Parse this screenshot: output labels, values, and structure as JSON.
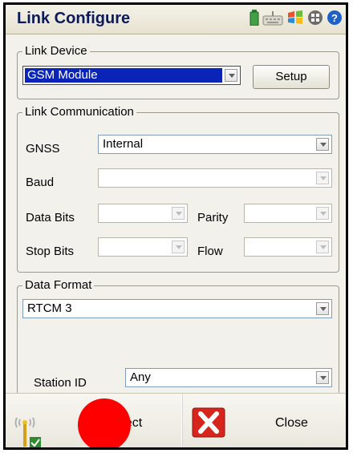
{
  "titlebar": {
    "title": "Link Configure"
  },
  "link_device": {
    "legend": "Link Device",
    "device_value": "GSM Module",
    "setup_label": "Setup"
  },
  "link_comm": {
    "legend": "Link Communication",
    "gnss_label": "GNSS",
    "gnss_value": "Internal",
    "baud_label": "Baud",
    "databits_label": "Data Bits",
    "parity_label": "Parity",
    "stopbits_label": "Stop Bits",
    "flow_label": "Flow"
  },
  "data_format": {
    "legend": "Data Format",
    "format_value": "RTCM 3",
    "station_label": "Station ID",
    "station_value": "Any"
  },
  "bottom_bar": {
    "connect_label": "nect",
    "close_label": "Close"
  },
  "colors": {
    "title": "#0c1a5a",
    "selection": "#0a24b8",
    "close_red": "#d8251c",
    "overlay_dot": "#ff0000"
  }
}
